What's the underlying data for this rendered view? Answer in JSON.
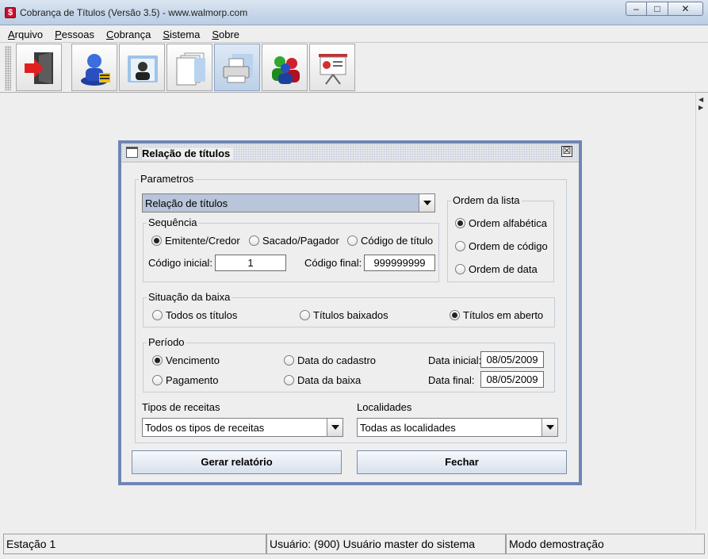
{
  "window": {
    "title": "Cobrança de Títulos (Versão 3.5) - www.walmorp.com",
    "app_icon": "$",
    "minimize": "–",
    "maximize": "□",
    "close": "✕"
  },
  "menu": [
    "Arquivo",
    "Pessoas",
    "Cobrança",
    "Sistema",
    "Sobre"
  ],
  "toolbar": {
    "icons": [
      "exit-door-icon",
      "user-card-icon",
      "contacts-folder-icon",
      "documents-icon",
      "printer-icon",
      "users-group-icon",
      "presentation-chart-icon"
    ],
    "active_index": 4
  },
  "dialog": {
    "title": "Relação de títulos",
    "close": "☒",
    "parametros": {
      "legend": "Parametros",
      "report_combo": "Relação de títulos"
    },
    "sequencia": {
      "legend": "Sequência",
      "options": [
        "Emitente/Credor",
        "Sacado/Pagador",
        "Código de título"
      ],
      "selected": 0,
      "codigo_inicial_label": "Código inicial:",
      "codigo_inicial": "1",
      "codigo_final_label": "Código final:",
      "codigo_final": "999999999"
    },
    "ordem": {
      "legend": "Ordem da lista",
      "options": [
        "Ordem alfabética",
        "Ordem de código",
        "Ordem de data"
      ],
      "selected": 0
    },
    "situacao": {
      "legend": "Situação da baixa",
      "options": [
        "Todos os títulos",
        "Títulos baixados",
        "Títulos em aberto"
      ],
      "selected": 2
    },
    "periodo": {
      "legend": "Período",
      "options": [
        "Vencimento",
        "Pagamento",
        "Data do cadastro",
        "Data da baixa"
      ],
      "selected": 0,
      "data_inicial_label": "Data inicial:",
      "data_inicial": "08/05/2009",
      "data_final_label": "Data final:",
      "data_final": "08/05/2009"
    },
    "tipos_receitas": {
      "label": "Tipos de receitas",
      "value": "Todos os tipos de receitas"
    },
    "localidades": {
      "label": "Localidades",
      "value": "Todas as localidades"
    },
    "buttons": {
      "gerar": "Gerar relatório",
      "fechar": "Fechar"
    }
  },
  "status": {
    "estacao": "Estação 1",
    "usuario": "Usuário: (900) Usuário master do sistema",
    "modo": "Modo demostração"
  }
}
